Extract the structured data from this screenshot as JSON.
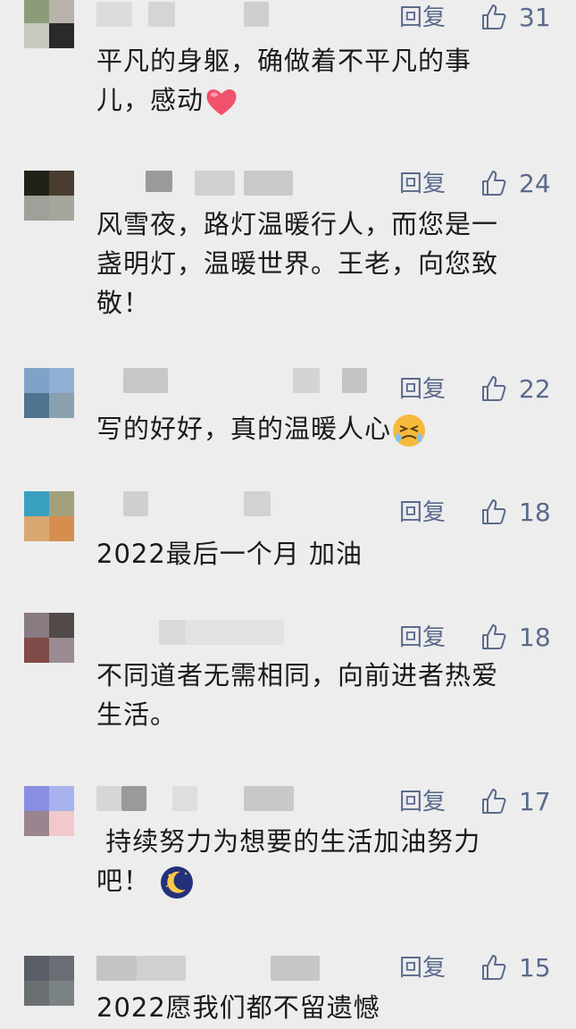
{
  "reply_label": "回复",
  "comments": [
    {
      "likes": "31",
      "text_lines": [
        "平凡的身躯，确做着不平凡的事",
        "儿，感动"
      ],
      "emoji": "red-heart"
    },
    {
      "likes": "24",
      "text_lines": [
        "风雪夜，路灯温暖行人，而您是一",
        "盏明灯，温暖世界。王老，向您致",
        "敬！"
      ]
    },
    {
      "likes": "22",
      "text_lines": [
        "写的好好，真的温暖人心"
      ],
      "emoji": "persevering-face"
    },
    {
      "likes": "18",
      "text_lines": [
        "2022最后一个月 加油"
      ]
    },
    {
      "likes": "18",
      "text_lines": [
        "不同道者无需相同，向前进者热爱",
        "生活。"
      ]
    },
    {
      "likes": "17",
      "text_lines": [
        " 持续努力为想要的生活加油努力",
        "吧！"
      ],
      "emoji": "crescent-moon"
    },
    {
      "likes": "15",
      "text_lines": [
        "2022愿我们都不留遗憾"
      ]
    }
  ]
}
